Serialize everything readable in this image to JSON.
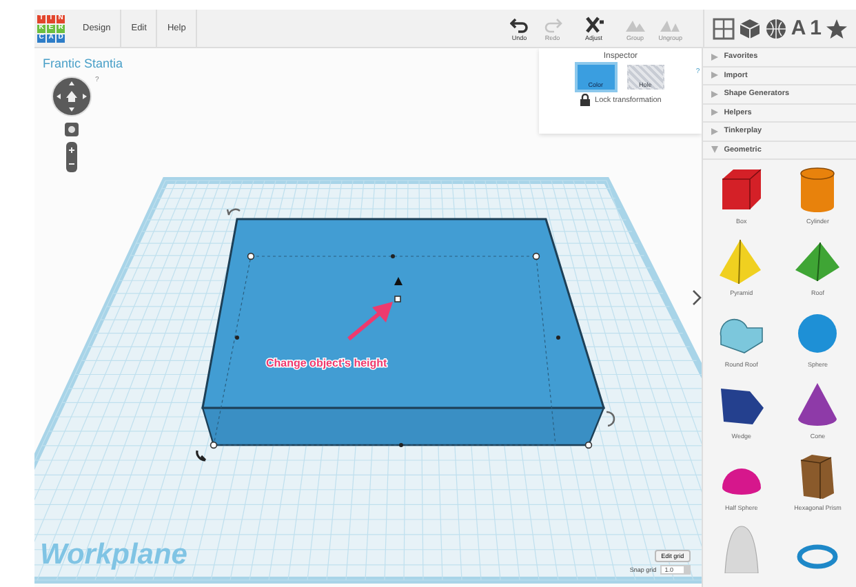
{
  "logo": {
    "letters": [
      "T",
      "I",
      "N",
      "K",
      "E",
      "R",
      "C",
      "A",
      "D"
    ]
  },
  "menu": [
    "Design",
    "Edit",
    "Help"
  ],
  "toolbar": [
    {
      "kind": "undo",
      "label": "Undo",
      "disabled": false
    },
    {
      "kind": "redo",
      "label": "Redo",
      "disabled": true
    },
    {
      "kind": "adjust",
      "label": "Adjust",
      "disabled": false
    },
    {
      "kind": "group",
      "label": "Group",
      "disabled": true
    },
    {
      "kind": "ungroup",
      "label": "Ungroup",
      "disabled": true
    }
  ],
  "library_tabs": [
    {
      "kind": "grid"
    },
    {
      "kind": "cube"
    },
    {
      "kind": "globe"
    },
    {
      "kind": "text",
      "label": "A"
    },
    {
      "kind": "text",
      "label": "1"
    },
    {
      "kind": "star"
    }
  ],
  "project_title": "Frantic Stantia",
  "view_help": "?",
  "inspector": {
    "title": "Inspector",
    "help": "?",
    "swatches": [
      {
        "kind": "solid",
        "label": "Color",
        "selected": true
      },
      {
        "kind": "hole",
        "label": "Hole",
        "selected": false
      }
    ],
    "lock_label": "Lock transformation"
  },
  "annotation": "Change object's height",
  "workplane_label": "Workplane",
  "edit_grid": "Edit grid",
  "snap_grid": {
    "label": "Snap grid",
    "value": "1.0"
  },
  "library_sections": [
    {
      "label": "Favorites",
      "expanded": false
    },
    {
      "label": "Import",
      "expanded": false
    },
    {
      "label": "Shape Generators",
      "expanded": false
    },
    {
      "label": "Helpers",
      "expanded": false
    },
    {
      "label": "Tinkerplay",
      "expanded": false
    },
    {
      "label": "Geometric",
      "expanded": true
    }
  ],
  "shapes": [
    {
      "kind": "box",
      "label": "Box",
      "color": "#d42027"
    },
    {
      "kind": "cylinder",
      "label": "Cylinder",
      "color": "#e8820c"
    },
    {
      "kind": "pyramid",
      "label": "Pyramid",
      "color": "#f0d020"
    },
    {
      "kind": "roof",
      "label": "Roof",
      "color": "#3fa535"
    },
    {
      "kind": "roundroof",
      "label": "Round Roof",
      "color": "#7cc7dc"
    },
    {
      "kind": "sphere",
      "label": "Sphere",
      "color": "#1e90d6"
    },
    {
      "kind": "wedge",
      "label": "Wedge",
      "color": "#24408e"
    },
    {
      "kind": "cone",
      "label": "Cone",
      "color": "#8e3aa8"
    },
    {
      "kind": "halfsphere",
      "label": "Half Sphere",
      "color": "#d6178c"
    },
    {
      "kind": "hexprism",
      "label": "Hexagonal Prism",
      "color": "#8a5a2b"
    },
    {
      "kind": "paraboloid",
      "color": "#d8d8d8"
    },
    {
      "kind": "torus",
      "color": "#1e88c8"
    }
  ]
}
